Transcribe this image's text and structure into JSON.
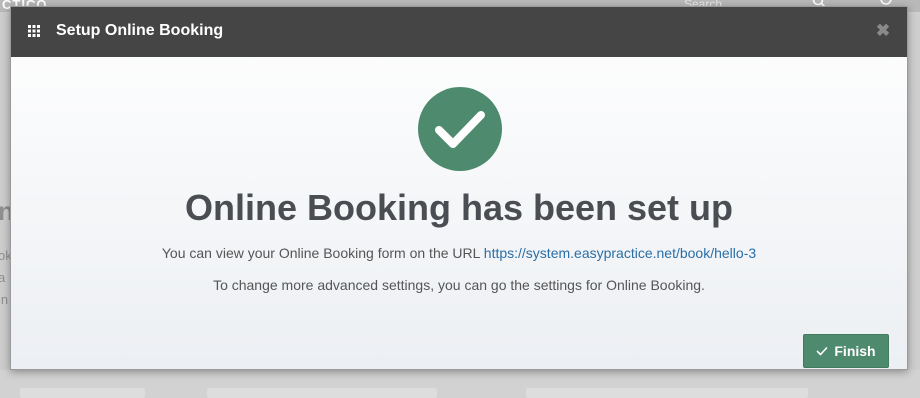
{
  "background": {
    "brand": "CTICO",
    "search_placeholder": "Search",
    "left_glyphs": [
      "n",
      "ok",
      "a",
      "in"
    ]
  },
  "modal": {
    "title": "Setup Online Booking",
    "close_symbol": "✖",
    "headline": "Online Booking has been set up",
    "url_prefix": "You can view your Online Booking form on the URL",
    "url": "https://system.easypractice.net/book/hello-3",
    "settings_text": "To change more advanced settings, you can go the settings for Online Booking.",
    "finish_label": "Finish"
  },
  "colors": {
    "header": "#454545",
    "success_green": "#4e8a6e",
    "link": "#2a6fa7",
    "headline": "#4a4d51"
  },
  "icons": {
    "header": "grid-icon",
    "status": "check-circle-icon",
    "close": "close-icon",
    "finish": "check-icon"
  }
}
